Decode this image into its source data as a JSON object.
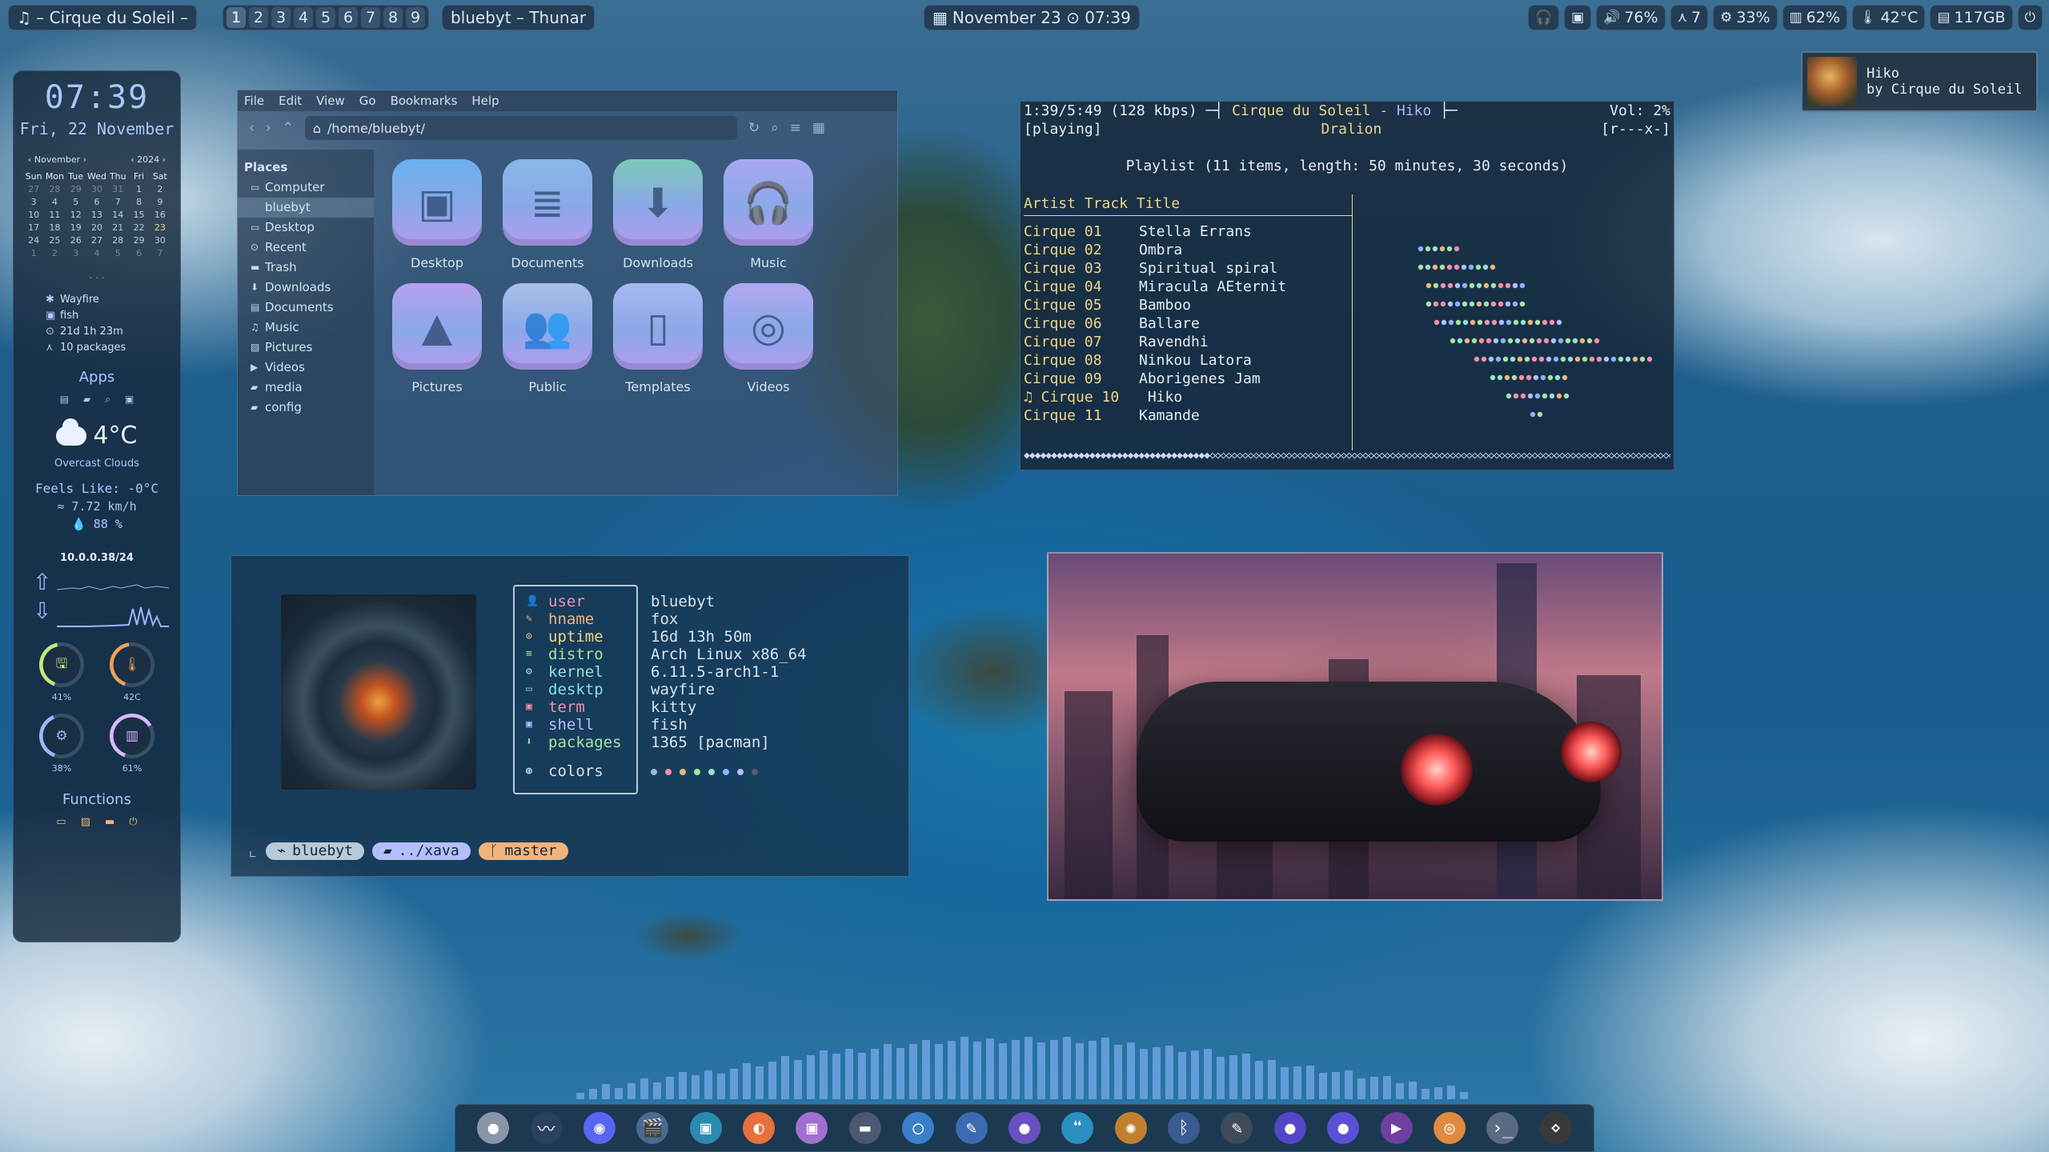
{
  "topbar": {
    "now_playing": "♫ – Cirque du Soleil –",
    "workspaces": [
      "1",
      "2",
      "3",
      "4",
      "5",
      "6",
      "7",
      "8",
      "9"
    ],
    "active_window": "bluebyt – Thunar",
    "datetime": "November 23 ⊙ 07:39",
    "status": [
      {
        "icon": "headphones-icon",
        "glyph": "🎧",
        "label": ""
      },
      {
        "icon": "terminal-icon",
        "glyph": "▣",
        "label": ""
      },
      {
        "icon": "volume-icon",
        "glyph": "🔊",
        "label": "76%"
      },
      {
        "icon": "updates-icon",
        "glyph": "⋏",
        "label": "7"
      },
      {
        "icon": "cpu-icon",
        "glyph": "⚙",
        "label": "33%"
      },
      {
        "icon": "memory-icon",
        "glyph": "▥",
        "label": "62%"
      },
      {
        "icon": "temperature-icon",
        "glyph": "🌡",
        "label": "42°C"
      },
      {
        "icon": "disk-icon",
        "glyph": "▤",
        "label": "117GB"
      },
      {
        "icon": "power-icon",
        "glyph": "⏻",
        "label": ""
      }
    ]
  },
  "notification": {
    "title": "Hiko",
    "subtitle": "by Cirque du Soleil"
  },
  "sidebar": {
    "time": "07:39",
    "date": "Fri, 22 November",
    "calendar": {
      "month": "November",
      "year": "2024",
      "days_header": [
        "Sun",
        "Mon",
        "Tue",
        "Wed",
        "Thu",
        "Fri",
        "Sat"
      ],
      "cells": [
        "27",
        "28",
        "29",
        "30",
        "31",
        "1",
        "2",
        "3",
        "4",
        "5",
        "6",
        "7",
        "8",
        "9",
        "10",
        "11",
        "12",
        "13",
        "14",
        "15",
        "16",
        "17",
        "18",
        "19",
        "20",
        "21",
        "22",
        "23",
        "24",
        "25",
        "26",
        "27",
        "28",
        "29",
        "30",
        "1",
        "2",
        "3",
        "4",
        "5",
        "6",
        "7"
      ]
    },
    "dots": ". . .",
    "sysinfo": [
      {
        "icon": "wayfire-icon",
        "glyph": "✱",
        "text": "Wayfire"
      },
      {
        "icon": "shell-icon",
        "glyph": "▣",
        "text": "fish"
      },
      {
        "icon": "uptime-icon",
        "glyph": "⊙",
        "text": "21d 1h 23m"
      },
      {
        "icon": "arch-icon",
        "glyph": "⋏",
        "text": "10 packages"
      }
    ],
    "apps_title": "Apps",
    "weather": {
      "temp": "4°C",
      "desc": "Overcast Clouds",
      "feels": "Feels Like: -0°C",
      "wind": "7.72 km/h",
      "humidity": "88 %"
    },
    "ip": "10.0.0.38/24",
    "gauges": [
      {
        "icon": "disk-icon",
        "glyph": "🖫",
        "label": "41%",
        "value": 0.41,
        "color": "#c7e87a"
      },
      {
        "icon": "temperature-icon",
        "glyph": "🌡",
        "label": "42C",
        "value": 0.42,
        "color": "#f0a05a"
      },
      {
        "icon": "cpu-icon",
        "glyph": "⚙",
        "label": "38%",
        "value": 0.38,
        "color": "#9fb4ff"
      },
      {
        "icon": "memory-icon",
        "glyph": "▥",
        "label": "61%",
        "value": 0.61,
        "color": "#d9b8ff"
      }
    ],
    "functions_title": "Functions"
  },
  "thunar": {
    "menu": [
      "File",
      "Edit",
      "View",
      "Go",
      "Bookmarks",
      "Help"
    ],
    "path": "/home/bluebyt/",
    "places_title": "Places",
    "places": [
      {
        "icon": "computer-icon",
        "label": "Computer",
        "indent": false
      },
      {
        "icon": "home-icon",
        "label": "bluebyt",
        "indent": true,
        "selected": true
      },
      {
        "icon": "desktop-icon",
        "label": "Desktop",
        "indent": false
      },
      {
        "icon": "recent-icon",
        "label": "Recent",
        "indent": false
      },
      {
        "icon": "trash-icon",
        "label": "Trash",
        "indent": false
      },
      {
        "icon": "downloads-icon",
        "label": "Downloads",
        "indent": false
      },
      {
        "icon": "documents-icon",
        "label": "Documents",
        "indent": false
      },
      {
        "icon": "music-icon",
        "label": "Music",
        "indent": false
      },
      {
        "icon": "pictures-icon",
        "label": "Pictures",
        "indent": false
      },
      {
        "icon": "videos-icon",
        "label": "Videos",
        "indent": false
      },
      {
        "icon": "folder-icon",
        "label": "media",
        "indent": false
      },
      {
        "icon": "folder-icon",
        "label": "config",
        "indent": false
      }
    ],
    "folders": [
      {
        "label": "Desktop",
        "icon": "desktop-folder-icon",
        "glyph": "▣",
        "color": "#6ab0f0"
      },
      {
        "label": "Documents",
        "icon": "documents-folder-icon",
        "glyph": "≣",
        "color": "#8ab8e8"
      },
      {
        "label": "Downloads",
        "icon": "downloads-folder-icon",
        "glyph": "⬇",
        "color": "#7ec8b8"
      },
      {
        "label": "Music",
        "icon": "music-folder-icon",
        "glyph": "🎧",
        "color": "#a8a8f0"
      },
      {
        "label": "Pictures",
        "icon": "pictures-folder-icon",
        "glyph": "▲",
        "color": "#b8a0f0"
      },
      {
        "label": "Public",
        "icon": "public-folder-icon",
        "glyph": "👥",
        "color": "#a8c0e8"
      },
      {
        "label": "Templates",
        "icon": "templates-folder-icon",
        "glyph": "▯",
        "color": "#a8b8f0"
      },
      {
        "label": "Videos",
        "icon": "videos-folder-icon",
        "glyph": "◎",
        "color": "#b0a8f0"
      }
    ]
  },
  "player": {
    "line1_left": "1:39/5:49 (128 kbps) ─┤ ",
    "line1_title": "Cirque du Soleil - ",
    "line1_track": "Hiko",
    "line1_tail": " ├─",
    "line1_right": "Vol: 2%",
    "line2_left": "[playing]",
    "line2_center": "Dralion",
    "line2_right": "[r---x-]",
    "playlist_summary": "Playlist (11 items, length: 50 minutes, 30 seconds)",
    "header": "Artist Track Title",
    "tracks": [
      {
        "artist": "Cirque 01",
        "title": "Stella Errans"
      },
      {
        "artist": "Cirque 02",
        "title": "Ombra"
      },
      {
        "artist": "Cirque 03",
        "title": "Spiritual spiral"
      },
      {
        "artist": "Cirque 04",
        "title": "Miracula AEternit"
      },
      {
        "artist": "Cirque 05",
        "title": "Bamboo"
      },
      {
        "artist": "Cirque 06",
        "title": "Ballare"
      },
      {
        "artist": "Cirque 07",
        "title": "Ravendhi"
      },
      {
        "artist": "Cirque 08",
        "title": "Ninkou Latora"
      },
      {
        "artist": "Cirque 09",
        "title": "Aborigenes Jam"
      },
      {
        "artist": "♫ Cirque 10",
        "title": " Hiko"
      },
      {
        "artist": "Cirque 11",
        "title": "Kamande"
      }
    ],
    "progress": 0.28
  },
  "fetch": {
    "keys": [
      {
        "icon": "user-icon",
        "glyph": "👤",
        "label": "user",
        "color": "#f28fad"
      },
      {
        "icon": "hostname-icon",
        "glyph": "✎",
        "label": "hname",
        "color": "#f0b47a"
      },
      {
        "icon": "uptime-icon",
        "glyph": "⊙",
        "label": "uptime",
        "color": "#f0d48a"
      },
      {
        "icon": "distro-icon",
        "glyph": "≡",
        "label": "distro",
        "color": "#a6e3a1"
      },
      {
        "icon": "kernel-icon",
        "glyph": "⚙",
        "label": "kernel",
        "color": "#94e2d5"
      },
      {
        "icon": "desktop-icon",
        "glyph": "▭",
        "label": "desktp",
        "color": "#89dceb"
      },
      {
        "icon": "terminal-icon",
        "glyph": "▣",
        "label": "term",
        "color": "#f28fad"
      },
      {
        "icon": "shell-icon",
        "glyph": "▣",
        "label": "shell",
        "color": "#b4befe"
      },
      {
        "icon": "packages-icon",
        "glyph": "⬇",
        "label": "packages",
        "color": "#a6e3a1"
      }
    ],
    "values": [
      "bluebyt",
      "fox",
      "16d 13h 50m",
      "Arch Linux x86_64",
      "6.11.5-arch1-1",
      "wayfire",
      "kitty",
      "fish",
      "1365 [pacman]"
    ],
    "colors_label": "colors",
    "palette": [
      "#9fb5ca",
      "#f28fad",
      "#f0b47a",
      "#a6e3a1",
      "#94e2d5",
      "#89b4fa",
      "#b4befe",
      "#585b70"
    ],
    "prompt": {
      "user": "bluebyt",
      "dir": "../xava",
      "branch": "master"
    }
  },
  "dock": [
    {
      "icon": "circle-app-icon",
      "glyph": "●",
      "bg": "#8a95a8"
    },
    {
      "icon": "system-monitor-icon",
      "glyph": "〰",
      "bg": "#2a4060"
    },
    {
      "icon": "discord-icon",
      "glyph": "◉",
      "bg": "#5865f2"
    },
    {
      "icon": "video-editor-icon",
      "glyph": "🎬",
      "bg": "#4a6a90"
    },
    {
      "icon": "terminal-icon",
      "glyph": "▣",
      "bg": "#2a8ab0"
    },
    {
      "icon": "firefox-icon",
      "glyph": "◐",
      "bg": "#e8703a"
    },
    {
      "icon": "kitty-icon",
      "glyph": "▣",
      "bg": "#a070d0"
    },
    {
      "icon": "folder-app-icon",
      "glyph": "▬",
      "bg": "#4a5870"
    },
    {
      "icon": "chromium-icon",
      "glyph": "◯",
      "bg": "#3a80c8"
    },
    {
      "icon": "tools-icon",
      "glyph": "✎",
      "bg": "#3a6ab0"
    },
    {
      "icon": "app-icon",
      "glyph": "●",
      "bg": "#6a50c0"
    },
    {
      "icon": "chat-icon",
      "glyph": "❝",
      "bg": "#2a90c0"
    },
    {
      "icon": "pinwheel-icon",
      "glyph": "✺",
      "bg": "#c08030"
    },
    {
      "icon": "bluetooth-icon",
      "glyph": "ᛒ",
      "bg": "#3a5a90"
    },
    {
      "icon": "editor-icon",
      "glyph": "✎",
      "bg": "#404a5a"
    },
    {
      "icon": "app2-icon",
      "glyph": "●",
      "bg": "#5048c8"
    },
    {
      "icon": "app3-icon",
      "glyph": "●",
      "bg": "#5a50d8"
    },
    {
      "icon": "media-player-icon",
      "glyph": "▶",
      "bg": "#7040a0"
    },
    {
      "icon": "browser-icon",
      "glyph": "◎",
      "bg": "#e08a40"
    },
    {
      "icon": "shell-app-icon",
      "glyph": "›_",
      "bg": "#5a6a80"
    },
    {
      "icon": "cat-icon",
      "glyph": "⋄",
      "bg": "#3a3a3a"
    }
  ]
}
